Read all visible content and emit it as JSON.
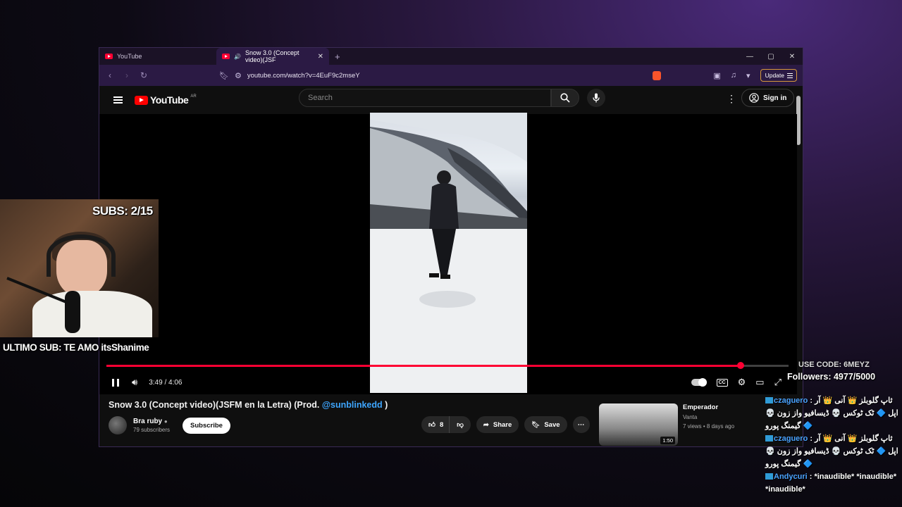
{
  "browser": {
    "tabs": [
      {
        "label": "YouTube",
        "active": false
      },
      {
        "label": "Snow 3.0 (Concept video)(JSF",
        "active": true
      }
    ],
    "new_tab": "+",
    "url": "youtube.com/watch?v=4EuF9c2mseY",
    "update_label": "Update"
  },
  "youtube": {
    "logo_text": "YouTube",
    "region": "AR",
    "search_placeholder": "Search",
    "sign_in": "Sign in"
  },
  "player": {
    "time": "3:49 / 4:06",
    "progress": 0.93,
    "accent": "#ff0033"
  },
  "video": {
    "title": "Snow 3.0 (Concept video)(JSFM en la Letra) (Prod. ",
    "title_handle": "@sunblinkedd",
    "title_end": " )",
    "channel": "Bra ruby",
    "subscribers": "79 subscribers",
    "subscribe_label": "Subscribe",
    "likes": "8",
    "share_label": "Share",
    "save_label": "Save"
  },
  "recommended": {
    "title": "Emperador",
    "channel": "Vanta",
    "meta": "7 views • 8 days ago",
    "duration": "1:50"
  },
  "stream": {
    "subs": "SUBS: 2/15",
    "last_sub": "ULTIMO SUB: TE AMO itsShanime",
    "use_code": "USE CODE: 6MEYZ",
    "followers": "Followers: 4977/5000",
    "chat": [
      {
        "user": "czaguero",
        "text": "ثاپ گلوبلز 👑 آنی 👑 آر اپل 🔷 ٹک ٹوکس 💀 ڈیسافیو واز زون 💀 گیمنگ پورو 🔷"
      },
      {
        "user": "czaguero",
        "text": "ثاپ گلوبلز 👑 آنی 👑 آر اپل 🔷 ٹک ٹوکس 💀 ڈیسافیو واز زون 💀 گیمنگ پورو 🔷"
      },
      {
        "user": "Andycuri",
        "text": "*inaudible* *inaudible* *inaudible*"
      }
    ]
  }
}
